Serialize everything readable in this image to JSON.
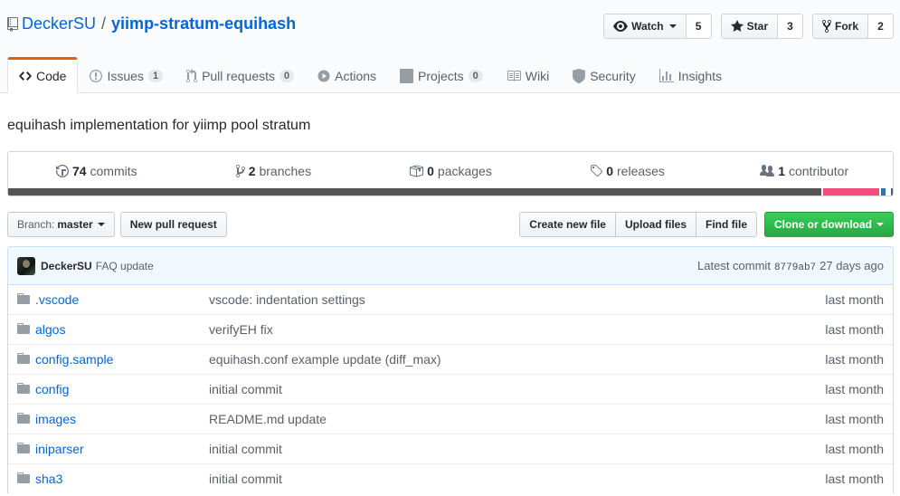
{
  "repo": {
    "owner": "DeckerSU",
    "separator": "/",
    "name": "yiimp-stratum-equihash",
    "description": "equihash implementation for yiimp pool stratum"
  },
  "actions": {
    "watch": {
      "label": "Watch",
      "count": "5",
      "icon": "eye-icon"
    },
    "star": {
      "label": "Star",
      "count": "3",
      "icon": "star-icon"
    },
    "fork": {
      "label": "Fork",
      "count": "2",
      "icon": "repo-forked-icon"
    }
  },
  "tabs": [
    {
      "label": "Code",
      "icon": "code-icon",
      "selected": true
    },
    {
      "label": "Issues",
      "count": "1",
      "icon": "issue-opened-icon"
    },
    {
      "label": "Pull requests",
      "count": "0",
      "icon": "git-pull-request-icon"
    },
    {
      "label": "Actions",
      "icon": "play-icon"
    },
    {
      "label": "Projects",
      "count": "0",
      "icon": "project-icon"
    },
    {
      "label": "Wiki",
      "icon": "book-icon"
    },
    {
      "label": "Security",
      "icon": "shield-icon"
    },
    {
      "label": "Insights",
      "icon": "graph-icon"
    }
  ],
  "summary": {
    "commits": {
      "count": "74",
      "label": "commits"
    },
    "branches": {
      "count": "2",
      "label": "branches"
    },
    "packages": {
      "count": "0",
      "label": "packages"
    },
    "releases": {
      "count": "0",
      "label": "releases"
    },
    "contributors": {
      "count": "1",
      "label": "contributor"
    }
  },
  "language_bar": [
    {
      "color": "#555555",
      "share": 92.4
    },
    {
      "color": "#f34b7d",
      "share": 6.4
    },
    {
      "color": "#3572A5",
      "share": 0.5
    },
    {
      "color": "#ffffff",
      "share": 0.2
    },
    {
      "color": "#4F5D95",
      "share": 0.2
    }
  ],
  "file_nav": {
    "branch_label": "Branch:",
    "branch_value": "master",
    "new_pull_request": "New pull request",
    "create_new_file": "Create new file",
    "upload_files": "Upload files",
    "find_file": "Find file",
    "clone_or_download": "Clone or download"
  },
  "latest_commit": {
    "author": "DeckerSU",
    "message": "FAQ update",
    "prefix": "Latest commit",
    "sha": "8779ab7",
    "age": "27 days ago"
  },
  "files": [
    {
      "name": ".vscode",
      "message": "vscode: indentation settings",
      "age": "last month"
    },
    {
      "name": "algos",
      "message": "verifyEH fix",
      "age": "last month"
    },
    {
      "name": "config.sample",
      "message": "equihash.conf example update (diff_max)",
      "age": "last month"
    },
    {
      "name": "config",
      "message": "initial commit",
      "age": "last month"
    },
    {
      "name": "images",
      "message": "README.md update",
      "age": "last month"
    },
    {
      "name": "iniparser",
      "message": "initial commit",
      "age": "last month"
    },
    {
      "name": "sha3",
      "message": "initial commit",
      "age": "last month"
    }
  ]
}
